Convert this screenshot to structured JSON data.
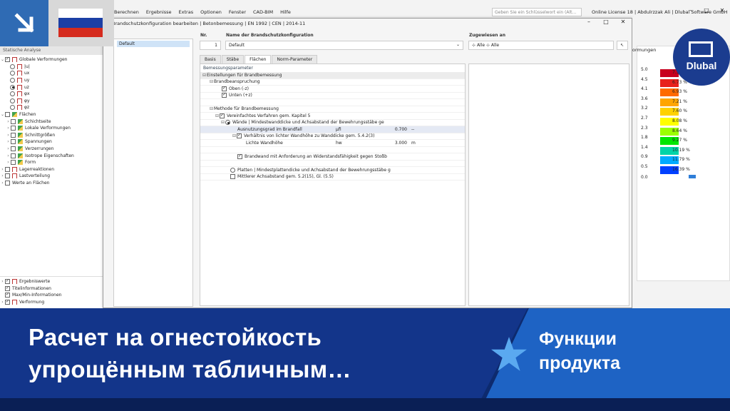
{
  "menu": {
    "items": [
      "Berechnen",
      "Ergebnisse",
      "Extras",
      "Optionen",
      "Fenster",
      "CAD-BIM",
      "Hilfe"
    ],
    "search_placeholder": "Geben Sie ein Schlüsselwort ein (Alt...",
    "license": "Online License 18 | Abdulrzzak Ali | Dlubal Software GmbH"
  },
  "navigator": {
    "title": "Statische Analyse",
    "items": [
      "Globale Verformungen",
      "|u|",
      "ux",
      "uy",
      "uz",
      "φx",
      "φy",
      "φz",
      "Flächen",
      "Schichtseite",
      "Lokale Verformungen",
      "Schnittgrößen",
      "Spannungen",
      "Verzerrungen",
      "Isotrope Eigenschaften",
      "Form",
      "Lagerreaktionen",
      "Lastverteilung",
      "Werte an Flächen"
    ],
    "bottom_items": [
      "Ergebniswerte",
      "Titelinformationen",
      "Max/Min-Informationen",
      "Verformung"
    ]
  },
  "dialog": {
    "title": "Brandschutzkonfiguration bearbeiten | Betonbemessung | EN 1992 | CEN | 2014-11",
    "list_item": "Default",
    "no_label": "Nr.",
    "no_value": "1",
    "name_label": "Name der Brandschutzkonfiguration",
    "name_value": "Default",
    "assigned_label": "Zugewiesen an",
    "assigned_value1": "Alle",
    "assigned_value2": "Alle",
    "tabs": [
      "Basis",
      "Stäbe",
      "Flächen",
      "Norm-Parameter"
    ],
    "panel_title": "Bemessungsparameter",
    "rows": [
      {
        "label": "Einstellungen für Brandbemessung",
        "sym": "",
        "val": "",
        "unit": ""
      },
      {
        "label": "Brandbeanspruchung",
        "sym": "",
        "val": "",
        "unit": ""
      },
      {
        "label": "Oben (-z)",
        "sym": "",
        "val": "",
        "unit": ""
      },
      {
        "label": "Unten (+z)",
        "sym": "",
        "val": "",
        "unit": ""
      },
      {
        "label": "",
        "sym": "",
        "val": "",
        "unit": ""
      },
      {
        "label": "Methode für Brandbemessung",
        "sym": "",
        "val": "",
        "unit": ""
      },
      {
        "label": "Vereinfachtes Verfahren gem. Kapitel 5",
        "sym": "",
        "val": "",
        "unit": ""
      },
      {
        "label": "Wände | Mindestwanddicke und Achsabstand der Bewehrungsstäbe ge",
        "sym": "",
        "val": "",
        "unit": ""
      },
      {
        "label": "Ausnutzungsgrad im Brandfall",
        "sym": "μfi",
        "val": "0.700",
        "unit": "--"
      },
      {
        "label": "Verhältnis von lichter Wandhöhe zu Wanddicke gem. 5.4.2(3)",
        "sym": "",
        "val": "",
        "unit": ""
      },
      {
        "label": "Lichte Wandhöhe",
        "sym": "hw",
        "val": "3.000",
        "unit": "m"
      },
      {
        "label": "",
        "sym": "",
        "val": "",
        "unit": ""
      },
      {
        "label": "Brandwand mit Anforderung an Widerstandsfähigkeit gegen Stoßb",
        "sym": "",
        "val": "",
        "unit": ""
      },
      {
        "label": "",
        "sym": "",
        "val": "",
        "unit": ""
      },
      {
        "label": "Platten | Mindestplattendicke und Achsabstand der Bewehrungsstäbe g",
        "sym": "",
        "val": "",
        "unit": ""
      },
      {
        "label": "Mittlerer Achsabstand gem. 5.2(15), Gl. (5.5)",
        "sym": "",
        "val": "",
        "unit": ""
      }
    ]
  },
  "legend": {
    "title": "ormungen",
    "rows": [
      {
        "v": "5.0",
        "p": "7.1",
        "color": "#c8001e"
      },
      {
        "v": "4.5",
        "p": "6.73 %",
        "color": "#e8211c"
      },
      {
        "v": "4.1",
        "p": "6.93 %",
        "color": "#ff6a00"
      },
      {
        "v": "3.6",
        "p": "7.21 %",
        "color": "#ffa500"
      },
      {
        "v": "3.2",
        "p": "7.60 %",
        "color": "#ffd200"
      },
      {
        "v": "2.7",
        "p": "8.08 %",
        "color": "#ffff00"
      },
      {
        "v": "2.3",
        "p": "8.64 %",
        "color": "#9cff00"
      },
      {
        "v": "1.8",
        "p": "9.27 %",
        "color": "#00e600"
      },
      {
        "v": "1.4",
        "p": "10.19 %",
        "color": "#00d4a8"
      },
      {
        "v": "0.9",
        "p": "11.79 %",
        "color": "#00aaff"
      },
      {
        "v": "0.5",
        "p": "16.39 %",
        "color": "#0040ff"
      }
    ],
    "end": "0.0",
    "last_color": "#0018c8"
  },
  "logo": {
    "text": "Dlubal"
  },
  "banner": {
    "title": "Расчет на огнестойкость упрощённым табличным…",
    "subtitle_line1": "Функции",
    "subtitle_line2": "продукта"
  },
  "colors": {
    "flag_white": "#ffffff",
    "flag_blue": "#1c3fa5",
    "flag_red": "#d52b1e",
    "accent_blue": "#2f6bb4"
  }
}
